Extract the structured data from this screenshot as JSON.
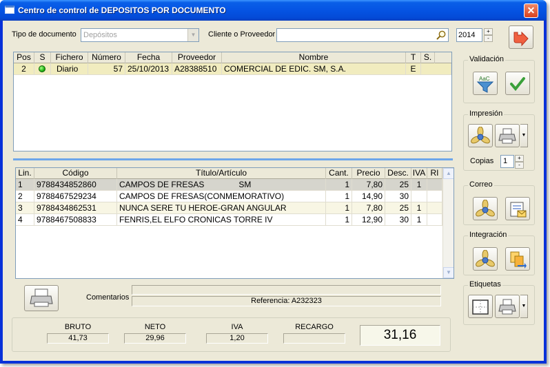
{
  "window": {
    "title": "Centro de control de DEPOSITOS POR DOCUMENTO",
    "close_label": "✕"
  },
  "filters": {
    "doc_type_label": "Tipo de documento",
    "doc_type_value": "Depósitos",
    "client_label": "Cliente o Proveedor",
    "client_value": "",
    "year": "2014"
  },
  "documents": {
    "columns": [
      "Pos",
      "S",
      "Fichero",
      "Número",
      "Fecha",
      "Proveedor",
      "Nombre",
      "T",
      "S."
    ],
    "rows": [
      {
        "pos": "2",
        "status": "green",
        "fichero": "Diario",
        "numero": "57",
        "fecha": "25/10/2013",
        "proveedor": "A28388510",
        "nombre": "COMERCIAL DE EDIC. SM, S.A.",
        "t": "E",
        "s": ""
      }
    ]
  },
  "lines": {
    "columns": [
      "Lin.",
      "Código",
      "Título/Artículo",
      "Cant.",
      "Precio",
      "Desc.",
      "IVA",
      "RI"
    ],
    "rows": [
      {
        "lin": "1",
        "codigo": "9788434852860",
        "titulo": "CAMPOS DE FRESAS               SM",
        "cant": "1",
        "precio": "7,80",
        "desc": "25",
        "iva": "1",
        "ri": ""
      },
      {
        "lin": "2",
        "codigo": "9788467529234",
        "titulo": "CAMPOS DE FRESAS(CONMEMORATIVO)",
        "cant": "1",
        "precio": "14,90",
        "desc": "30",
        "iva": "",
        "ri": ""
      },
      {
        "lin": "3",
        "codigo": "9788434862531",
        "titulo": "NUNCA SERE TU HEROE-GRAN ANGULAR",
        "cant": "1",
        "precio": "7,80",
        "desc": "25",
        "iva": "1",
        "ri": ""
      },
      {
        "lin": "4",
        "codigo": "9788467508833",
        "titulo": "FENRIS,EL ELFO CRONICAS TORRE IV",
        "cant": "1",
        "precio": "12,90",
        "desc": "30",
        "iva": "1",
        "ri": ""
      }
    ]
  },
  "comments": {
    "label": "Comentarios",
    "value": "",
    "reference": "Referencia: A232323"
  },
  "totals": {
    "bruto_label": "BRUTO",
    "bruto": "41,73",
    "neto_label": "NETO",
    "neto": "29,96",
    "iva_label": "IVA",
    "iva": "1,20",
    "recargo_label": "RECARGO",
    "recargo": "",
    "total": "31,16"
  },
  "panels": {
    "validacion": "Validación",
    "impresion": "Impresión",
    "copias_label": "Copias",
    "copias": "1",
    "correo": "Correo",
    "integracion": "Integración",
    "etiquetas": "Etiquetas"
  },
  "icons": {
    "exit": "exit-arrow-icon",
    "validate_filter": "funnel-filter-icon",
    "validate_check": "checkmark-icon",
    "fan": "fan-icon",
    "printer": "printer-icon",
    "mail_doc": "mail-document-icon",
    "integrate": "integrate-documents-icon",
    "labels": "labels-grid-icon"
  }
}
